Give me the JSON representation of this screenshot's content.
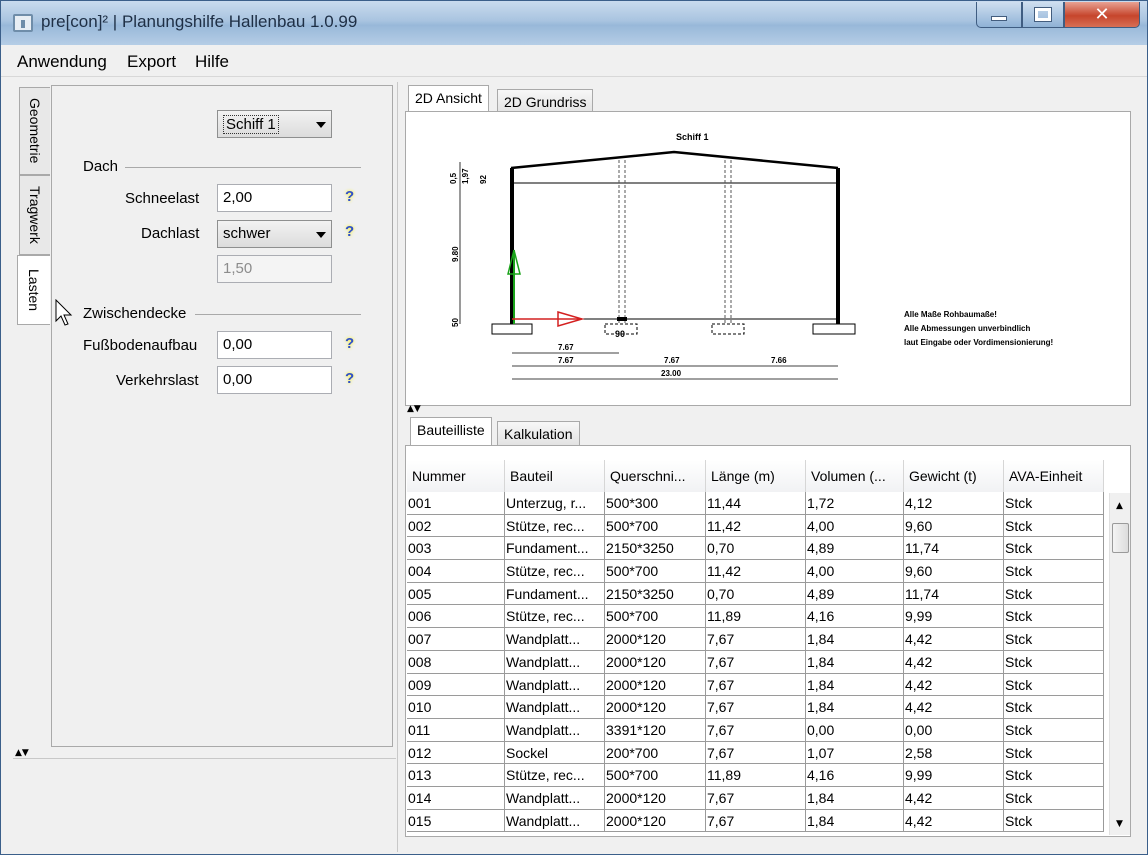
{
  "window": {
    "title": "pre[con]² | Planungshilfe Hallenbau 1.0.99",
    "minimize_symbol": "",
    "close_symbol": "✕"
  },
  "menu": [
    "Anwendung",
    "Export",
    "Hilfe"
  ],
  "side_tabs": [
    "Geometrie",
    "Tragwerk",
    "Lasten"
  ],
  "form": {
    "ship_select": "Schiff 1",
    "section_dach": "Dach",
    "schneelast_label": "Schneelast",
    "schneelast_value": "2,00",
    "dachlast_label": "Dachlast",
    "dachlast_value": "schwer",
    "dachlast_computed": "1,50",
    "section_zwischendecke": "Zwischendecke",
    "fussboden_label": "Fußbodenaufbau",
    "fussboden_value": "0,00",
    "verkehrslast_label": "Verkehrslast",
    "verkehrslast_value": "0,00",
    "help_symbol": "?"
  },
  "view_tabs": [
    "2D Ansicht",
    "2D Grundriss"
  ],
  "drawing": {
    "title": "Schiff 1",
    "dim_left_top": [
      "0,5",
      "1,97",
      "92"
    ],
    "dim_height": "9.80",
    "dim_bottom": "50",
    "foundation_label": "90",
    "dims_row1": "7.67",
    "dims_row2": [
      "7.67",
      "7.67",
      "7.66"
    ],
    "dims_total": "23.00",
    "notes": [
      "Alle Maße Rohbaumaße!",
      "Alle Abmessungen unverbindlich",
      "laut Eingabe oder Vordimensionierung!"
    ]
  },
  "lower_tabs": [
    "Bauteilliste",
    "Kalkulation"
  ],
  "table": {
    "headers": [
      "Nummer",
      "Bauteil",
      "Querschni...",
      "Länge (m)",
      "Volumen (...",
      "Gewicht (t)",
      "AVA-Einheit"
    ],
    "rows": [
      [
        "001",
        "Unterzug, r...",
        "500*300",
        "11,44",
        "1,72",
        "4,12",
        "Stck"
      ],
      [
        "002",
        "Stütze, rec...",
        "500*700",
        "11,42",
        "4,00",
        "9,60",
        "Stck"
      ],
      [
        "003",
        "Fundament...",
        "2150*3250",
        "0,70",
        "4,89",
        "11,74",
        "Stck"
      ],
      [
        "004",
        "Stütze, rec...",
        "500*700",
        "11,42",
        "4,00",
        "9,60",
        "Stck"
      ],
      [
        "005",
        "Fundament...",
        "2150*3250",
        "0,70",
        "4,89",
        "11,74",
        "Stck"
      ],
      [
        "006",
        "Stütze, rec...",
        "500*700",
        "11,89",
        "4,16",
        "9,99",
        "Stck"
      ],
      [
        "007",
        "Wandplatt...",
        "2000*120",
        "7,67",
        "1,84",
        "4,42",
        "Stck"
      ],
      [
        "008",
        "Wandplatt...",
        "2000*120",
        "7,67",
        "1,84",
        "4,42",
        "Stck"
      ],
      [
        "009",
        "Wandplatt...",
        "2000*120",
        "7,67",
        "1,84",
        "4,42",
        "Stck"
      ],
      [
        "010",
        "Wandplatt...",
        "2000*120",
        "7,67",
        "1,84",
        "4,42",
        "Stck"
      ],
      [
        "011",
        "Wandplatt...",
        "3391*120",
        "7,67",
        "0,00",
        "0,00",
        "Stck"
      ],
      [
        "012",
        "Sockel",
        "200*700",
        "7,67",
        "1,07",
        "2,58",
        "Stck"
      ],
      [
        "013",
        "Stütze, rec...",
        "500*700",
        "11,89",
        "4,16",
        "9,99",
        "Stck"
      ],
      [
        "014",
        "Wandplatt...",
        "2000*120",
        "7,67",
        "1,84",
        "4,42",
        "Stck"
      ],
      [
        "015",
        "Wandplatt...",
        "2000*120",
        "7,67",
        "1,84",
        "4,42",
        "Stck"
      ]
    ]
  }
}
